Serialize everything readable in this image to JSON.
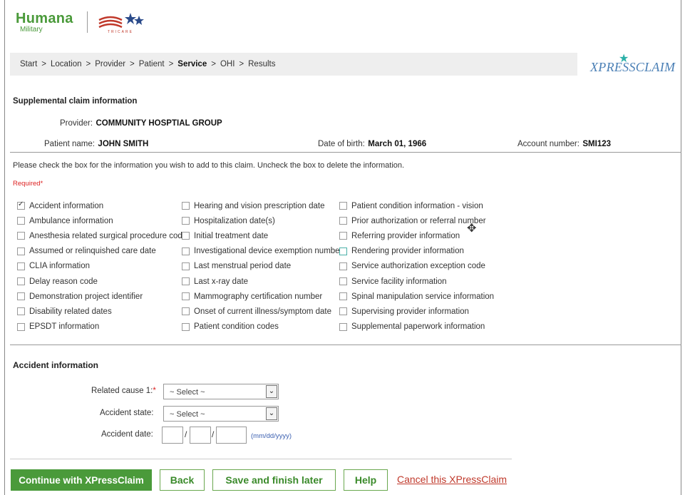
{
  "brand": {
    "humana": "Humana",
    "military": "Military",
    "tricare_text": "TRICARE",
    "xpress_logo": "XPRESSCLAIM"
  },
  "breadcrumb": [
    {
      "label": "Start",
      "current": false
    },
    {
      "label": "Location",
      "current": false
    },
    {
      "label": "Provider",
      "current": false
    },
    {
      "label": "Patient",
      "current": false
    },
    {
      "label": "Service",
      "current": true
    },
    {
      "label": "OHI",
      "current": false
    },
    {
      "label": "Results",
      "current": false
    }
  ],
  "breadcrumb_sep": ">",
  "section": {
    "title": "Supplemental claim information",
    "provider_label": "Provider:",
    "provider_value": "COMMUNITY HOSPTIAL GROUP",
    "patient_label": "Patient name:",
    "patient_value": "JOHN SMITH",
    "dob_label": "Date of birth:",
    "dob_value": "March 01, 1966",
    "account_label": "Account number:",
    "account_value": "SMI123"
  },
  "instructions": "Please check the box for the information you wish to add to this claim. Uncheck the box to delete the information.",
  "required_label": "Required*",
  "checkbox_columns": [
    [
      {
        "label": "Accident information",
        "checked": true
      },
      {
        "label": "Ambulance information",
        "checked": false
      },
      {
        "label": "Anesthesia related surgical procedure code",
        "checked": false
      },
      {
        "label": "Assumed or relinquished care date",
        "checked": false
      },
      {
        "label": "CLIA information",
        "checked": false
      },
      {
        "label": "Delay reason code",
        "checked": false
      },
      {
        "label": "Demonstration project identifier",
        "checked": false
      },
      {
        "label": "Disability related dates",
        "checked": false
      },
      {
        "label": "EPSDT information",
        "checked": false
      }
    ],
    [
      {
        "label": "Hearing and vision prescription date",
        "checked": false
      },
      {
        "label": "Hospitalization date(s)",
        "checked": false
      },
      {
        "label": "Initial treatment date",
        "checked": false
      },
      {
        "label": "Investigational device exemption number",
        "checked": false
      },
      {
        "label": "Last menstrual period date",
        "checked": false
      },
      {
        "label": "Last x-ray date",
        "checked": false
      },
      {
        "label": "Mammography certification number",
        "checked": false
      },
      {
        "label": "Onset of current illness/symptom date",
        "checked": false
      },
      {
        "label": "Patient condition codes",
        "checked": false
      }
    ],
    [
      {
        "label": "Patient condition information - vision",
        "checked": false
      },
      {
        "label": "Prior authorization or referral number",
        "checked": false
      },
      {
        "label": "Referring provider information",
        "checked": false
      },
      {
        "label": "Rendering provider information",
        "checked": false,
        "focused": true
      },
      {
        "label": "Service authorization exception code",
        "checked": false
      },
      {
        "label": "Service facility information",
        "checked": false
      },
      {
        "label": "Spinal manipulation service information",
        "checked": false
      },
      {
        "label": "Supervising provider information",
        "checked": false
      },
      {
        "label": "Supplemental paperwork information",
        "checked": false
      }
    ]
  ],
  "accident": {
    "title": "Accident information",
    "related_cause_label": "Related cause 1:",
    "related_cause_required": "*",
    "related_cause_value": "~ Select ~",
    "state_label": "Accident state:",
    "state_value": "~ Select ~",
    "date_label": "Accident date:",
    "date_slash": "/",
    "date_hint": "(mm/dd/yyyy)"
  },
  "buttons": {
    "continue": "Continue with XPressClaim",
    "back": "Back",
    "save": "Save and finish later",
    "help": "Help",
    "cancel": "Cancel this XPressClaim"
  },
  "colors": {
    "brand_green": "#4a9a3a",
    "link_red": "#c0392b",
    "required_red": "#dd2222"
  }
}
